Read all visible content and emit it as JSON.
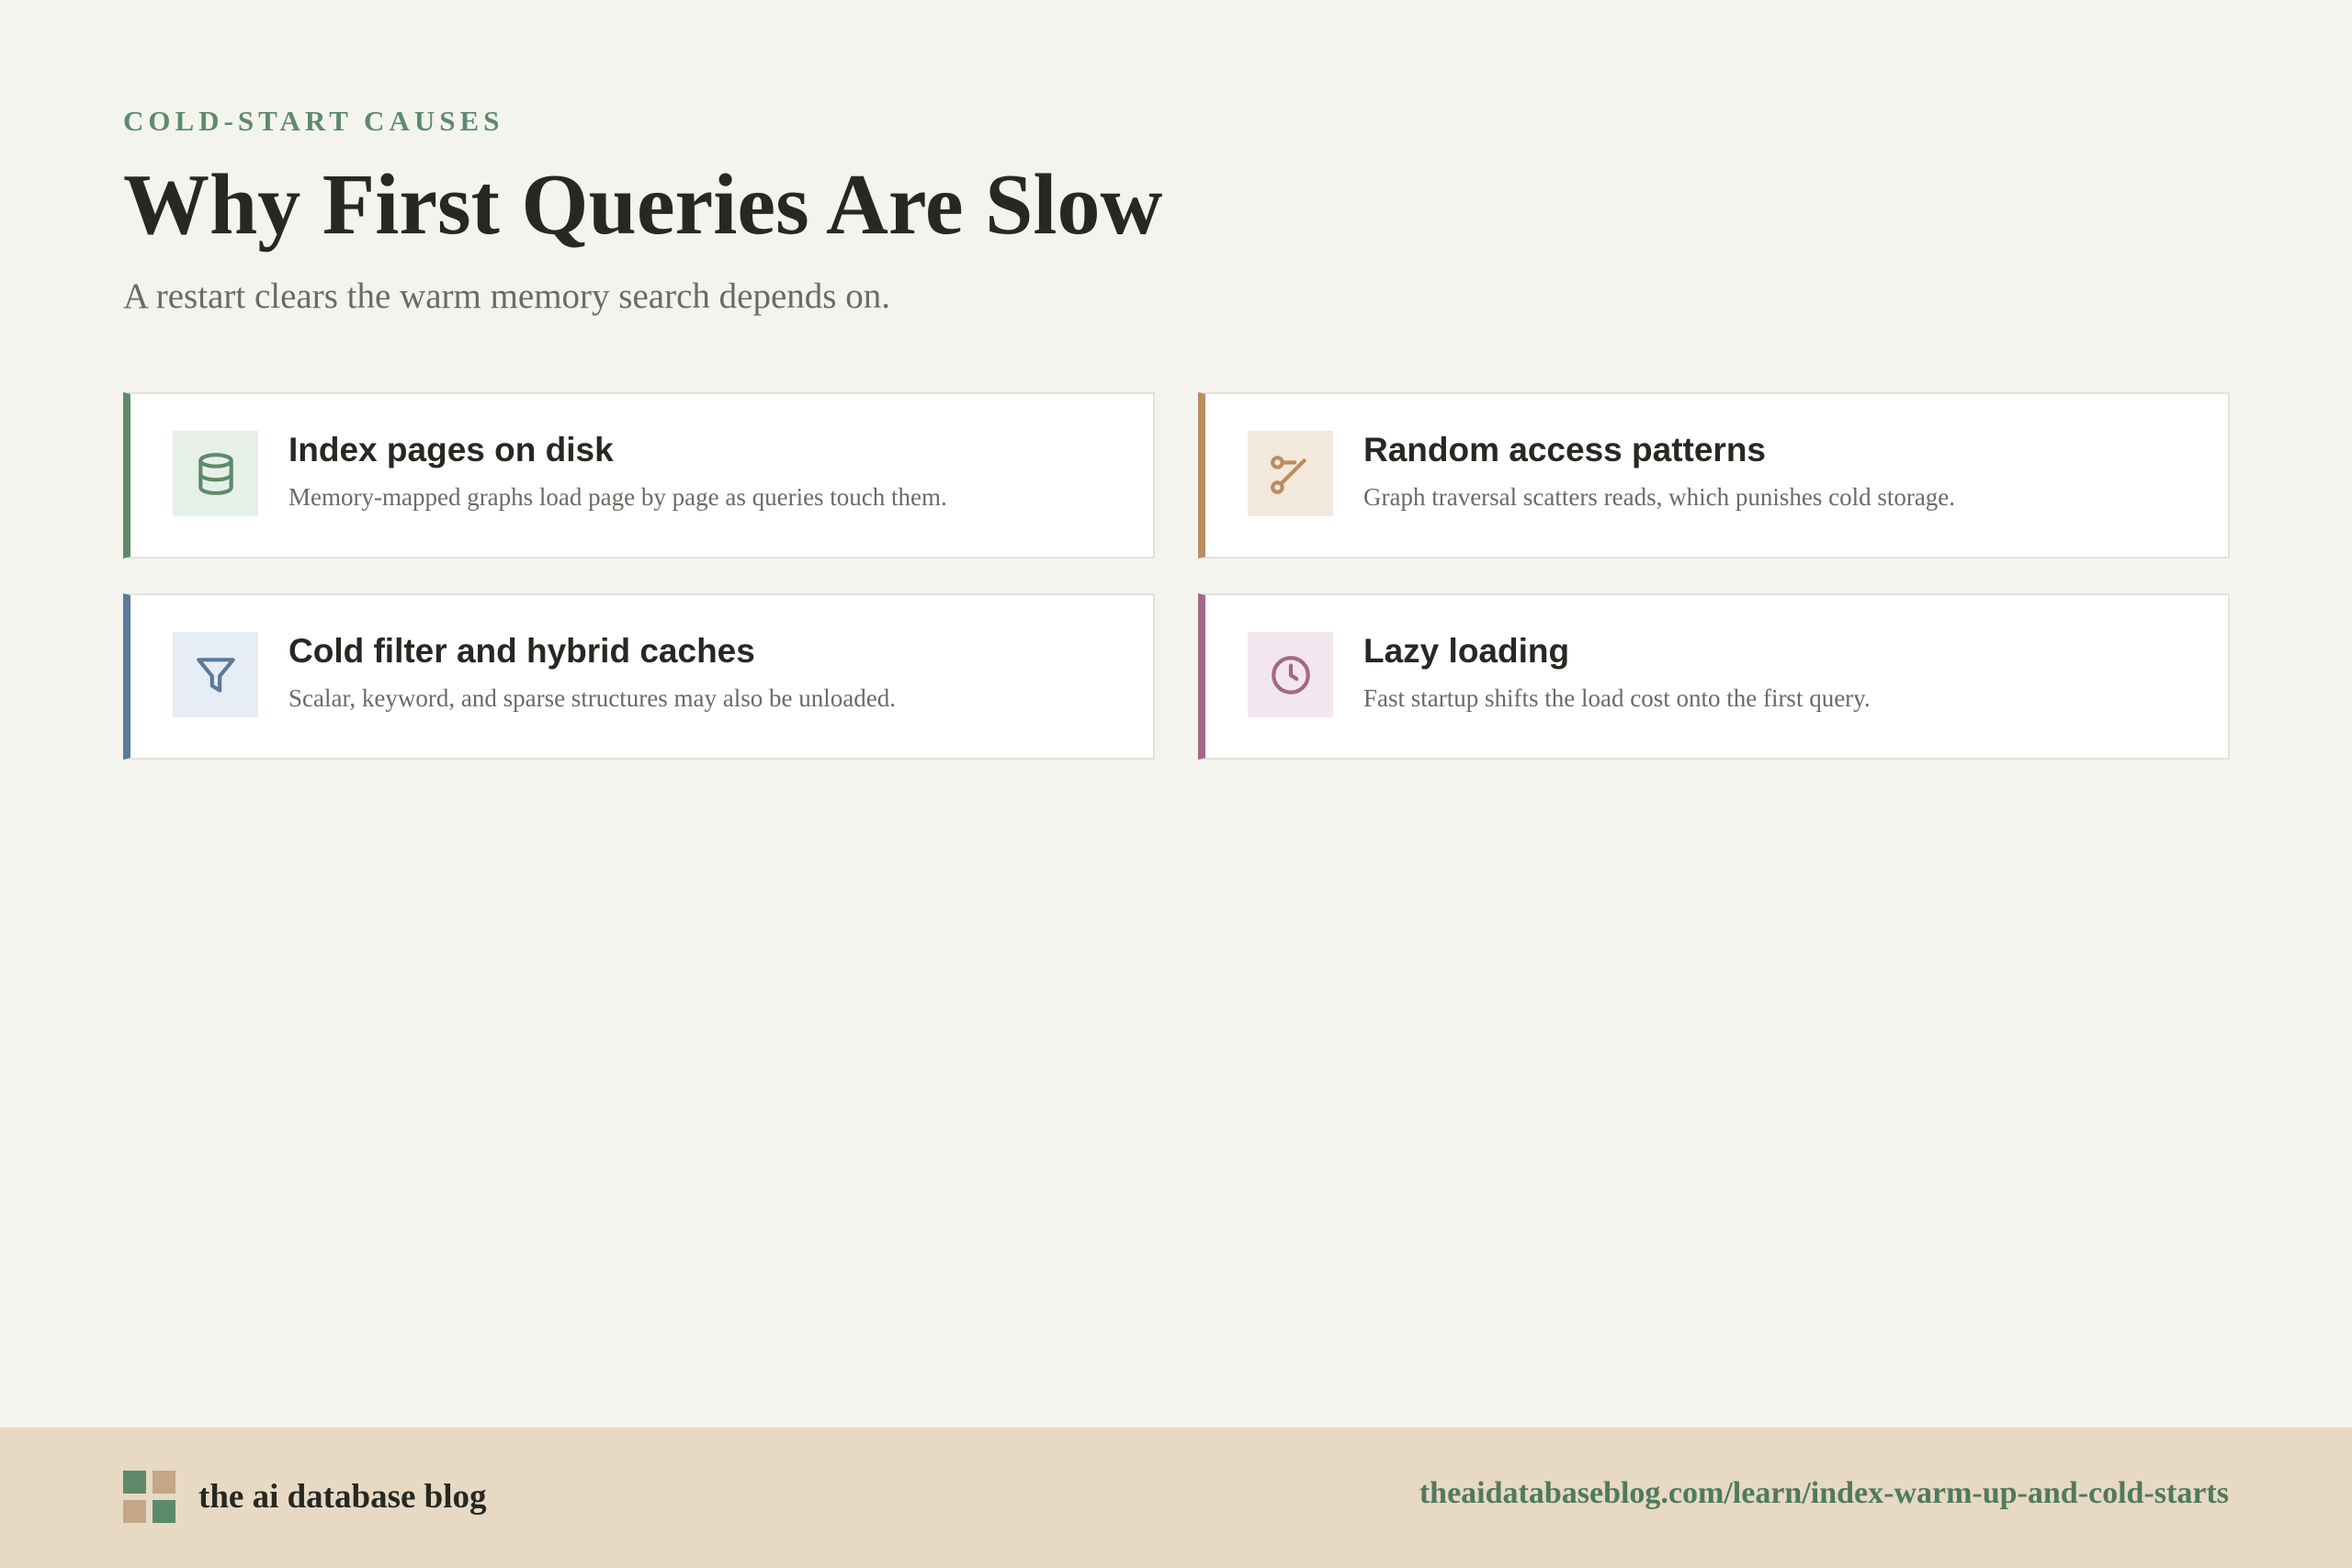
{
  "header": {
    "eyebrow": "COLD-START CAUSES",
    "title": "Why First Queries Are Slow",
    "subtitle": "A restart clears the warm memory search depends on."
  },
  "cards": [
    {
      "title": "Index pages on disk",
      "description": "Memory-mapped graphs load page by page as queries touch them.",
      "icon": "database-icon",
      "accent": "#5e8a6c"
    },
    {
      "title": "Random access patterns",
      "description": "Graph traversal scatters reads, which punishes cold storage.",
      "icon": "route-icon",
      "accent": "#b98d5e"
    },
    {
      "title": "Cold filter and hybrid caches",
      "description": "Scalar, keyword, and sparse structures may also be unloaded.",
      "icon": "filter-icon",
      "accent": "#5b7a9c"
    },
    {
      "title": "Lazy loading",
      "description": "Fast startup shifts the load cost onto the first query.",
      "icon": "clock-icon",
      "accent": "#a3678a"
    }
  ],
  "footer": {
    "brand": "the ai database blog",
    "url": "theaidatabaseblog.com/learn/index-warm-up-and-cold-starts"
  }
}
